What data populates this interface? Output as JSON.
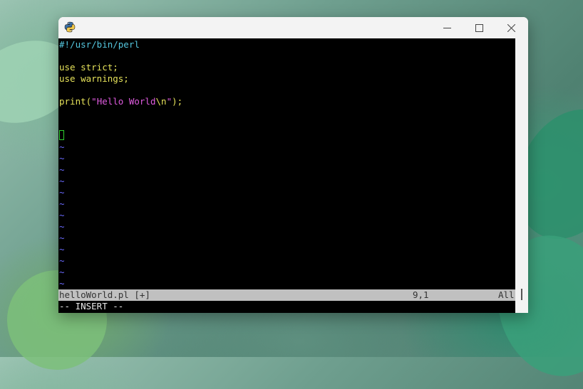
{
  "window": {
    "app_icon": "python-icon",
    "controls": {
      "minimize": "minimize-icon",
      "maximize": "maximize-icon",
      "close": "close-icon"
    }
  },
  "editor": {
    "shebang": "#!/usr/bin/perl",
    "use_strict": "use strict;",
    "use_warnings": "use warnings;",
    "print_keyword": "print",
    "print_open": "(",
    "print_string_open": "\"",
    "print_string_text": "Hello World",
    "print_string_escape": "\\n",
    "print_string_close": "\"",
    "print_close": ");",
    "empty_line_marker": "~",
    "colors": {
      "comment": "#55c8e0",
      "keyword": "#e6e25a",
      "string": "#e05ce0",
      "tilde": "#6a6aff",
      "cursor": "#2fd12f"
    }
  },
  "statusline": {
    "filename": "helloWorld.pl [+]",
    "position": "9,1",
    "scroll": "All"
  },
  "mode_line": "-- INSERT --"
}
